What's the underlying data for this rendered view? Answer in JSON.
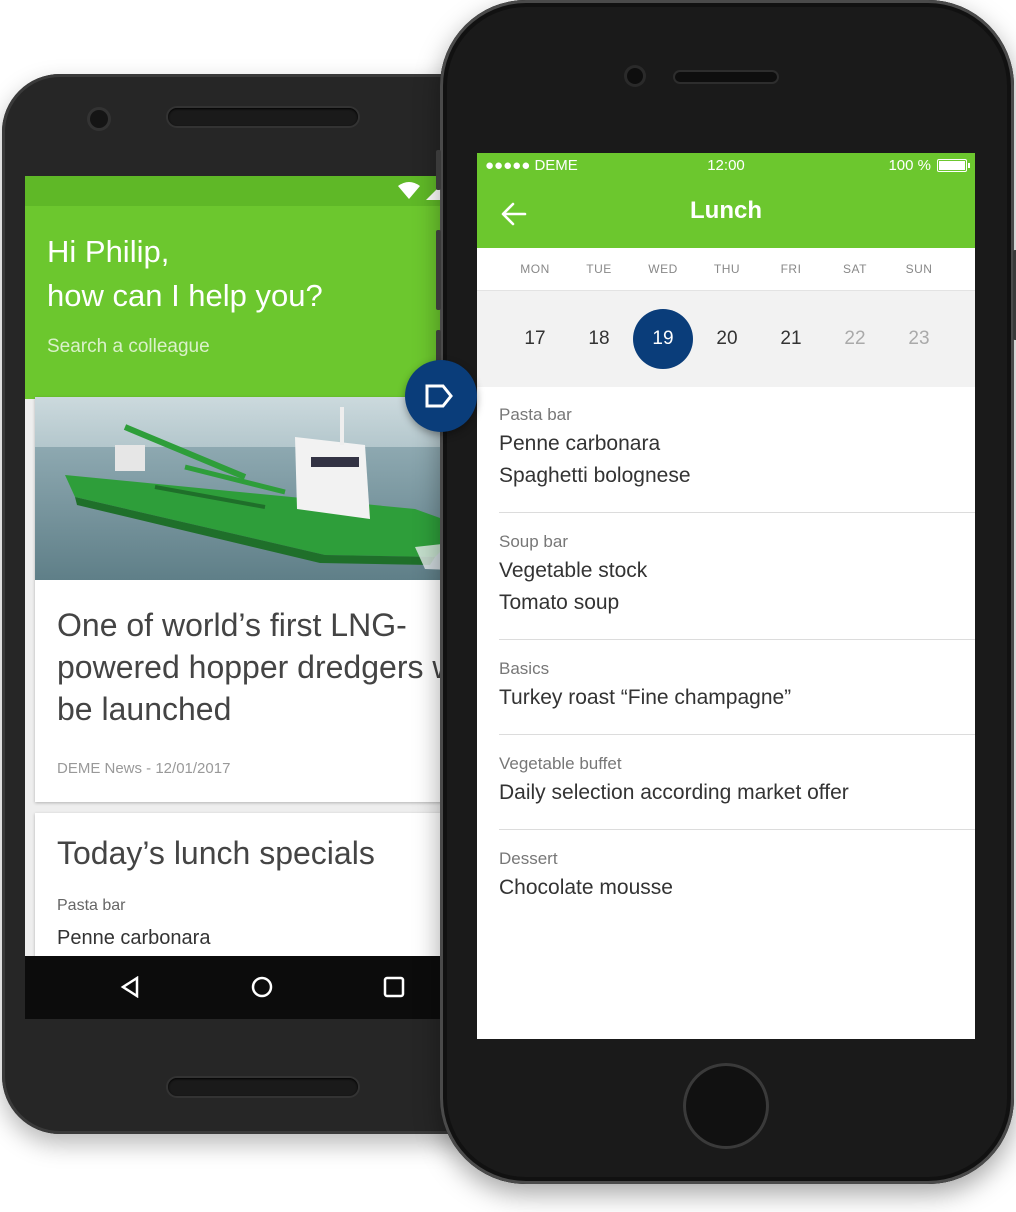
{
  "android": {
    "status_icons": [
      "wifi-icon",
      "signal-icon",
      "battery-icon"
    ],
    "greeting_line1": "Hi Philip,",
    "greeting_line2": "how can I help you?",
    "search_placeholder": "Search a colleague",
    "news_card": {
      "image": "dredger-ship-image",
      "title": "One of world’s first LNG-powered hopper dredgers will be launched",
      "meta": "DEME News - 12/01/2017"
    },
    "lunch_card": {
      "title": "Today’s lunch specials",
      "category": "Pasta bar",
      "item": "Penne carbonara"
    },
    "nav_icons": [
      "back-icon",
      "home-icon",
      "recents-icon"
    ]
  },
  "iphone": {
    "status": {
      "carrier": "●●●●● DEME",
      "time": "12:00",
      "battery": "100 %"
    },
    "title": "Lunch",
    "weekdays": [
      "MON",
      "TUE",
      "WED",
      "THU",
      "FRI",
      "SAT",
      "SUN"
    ],
    "dates": [
      "17",
      "18",
      "19",
      "20",
      "21",
      "22",
      "23"
    ],
    "selected_date": "19",
    "menu": [
      {
        "category": "Pasta bar",
        "items": [
          "Penne carbonara",
          "Spaghetti bolognese"
        ]
      },
      {
        "category": "Soup bar",
        "items": [
          "Vegetable stock",
          "Tomato soup"
        ]
      },
      {
        "category": "Basics",
        "items": [
          "Turkey roast “Fine champagne”"
        ]
      },
      {
        "category": "Vegetable buffet",
        "items": [
          "Daily selection according market offer"
        ]
      },
      {
        "category": "Dessert",
        "items": [
          "Chocolate mousse"
        ]
      }
    ]
  },
  "colors": {
    "green": "#6cc72e",
    "navy": "#0a3d7a"
  }
}
